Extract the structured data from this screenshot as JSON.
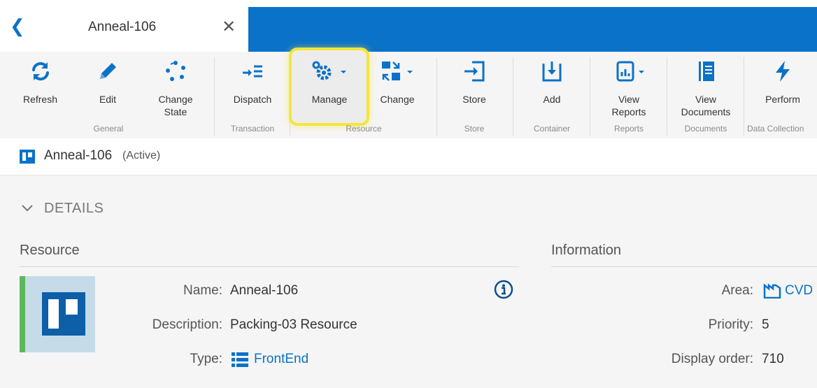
{
  "tab": {
    "title": "Anneal-106"
  },
  "ribbon": {
    "buttons": [
      {
        "label": "Refresh"
      },
      {
        "label": "Edit"
      },
      {
        "label": "Change\nState"
      },
      {
        "label": "Dispatch"
      },
      {
        "label": "Manage"
      },
      {
        "label": "Change"
      },
      {
        "label": "Store"
      },
      {
        "label": "Add"
      },
      {
        "label": "View\nReports"
      },
      {
        "label": "View\nDocuments"
      },
      {
        "label": "Perform"
      }
    ],
    "groups": [
      "General",
      "Transaction",
      "Resource",
      "Store",
      "Container",
      "Reports",
      "Documents",
      "Data Collection"
    ]
  },
  "breadcrumb": {
    "name": "Anneal-106",
    "status": "(Active)"
  },
  "details": {
    "header": "DETAILS"
  },
  "resource": {
    "title": "Resource",
    "fields": [
      {
        "label": "Name:",
        "value": "Anneal-106"
      },
      {
        "label": "Description:",
        "value": "Packing-03 Resource"
      },
      {
        "label": "Type:",
        "value": "FrontEnd"
      }
    ]
  },
  "information": {
    "title": "Information",
    "fields": [
      {
        "label": "Area:",
        "value": "CVD"
      },
      {
        "label": "Priority:",
        "value": "5"
      },
      {
        "label": "Display order:",
        "value": "710"
      }
    ]
  },
  "colors": {
    "accent": "#0a72c8",
    "highlight": "#f5e53a",
    "status_bar": "#5cb85c"
  }
}
